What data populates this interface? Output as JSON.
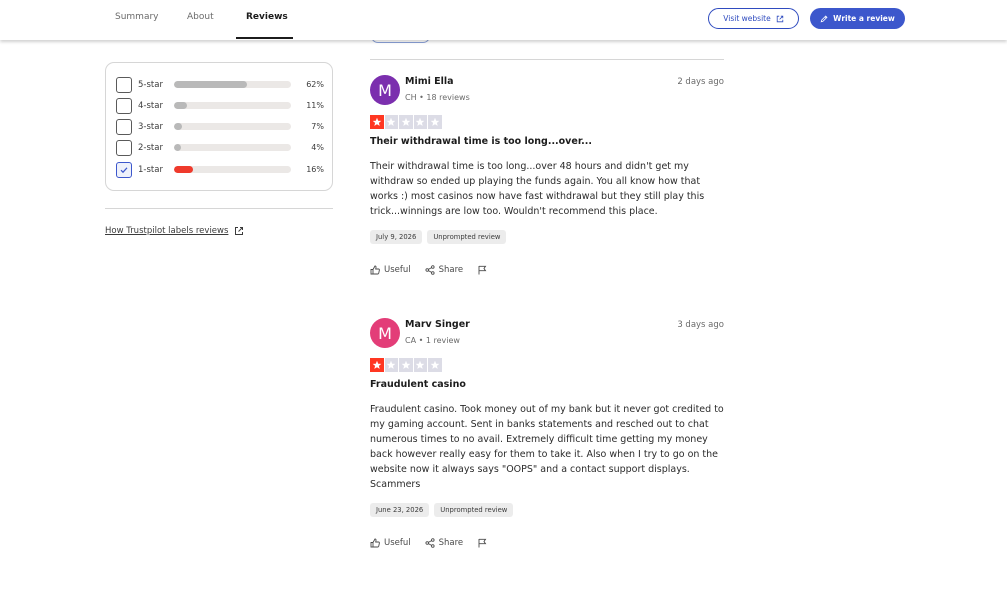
{
  "nav": {
    "tabs": [
      {
        "label": "Summary",
        "active": false
      },
      {
        "label": "About",
        "active": false
      },
      {
        "label": "Reviews",
        "active": true
      }
    ],
    "visit_label": "Visit website",
    "write_label": "Write a review"
  },
  "filter": {
    "rows": [
      {
        "label": "5-star",
        "percent": "62%",
        "fill": 0.62,
        "checked": false
      },
      {
        "label": "4-star",
        "percent": "11%",
        "fill": 0.11,
        "checked": false
      },
      {
        "label": "3-star",
        "percent": "7%",
        "fill": 0.07,
        "checked": false
      },
      {
        "label": "2-star",
        "percent": "4%",
        "fill": 0.04,
        "checked": false
      },
      {
        "label": "1-star",
        "percent": "16%",
        "fill": 0.16,
        "checked": true
      }
    ],
    "labels_link": "How Trustpilot labels reviews"
  },
  "reviews": [
    {
      "initial": "M",
      "avatar_color": "#7b2fae",
      "name": "Mimi Ella",
      "meta": "CH • 18 reviews",
      "date": "2 days ago",
      "rating": 1,
      "title": "Their withdrawal time is too long...over...",
      "body": "Their withdrawal time is too long...over 48 hours and didn't get my withdraw so ended up playing the funds again. You all know how that works :) most casinos now have fast withdrawal but they still play this trick...winnings are low too. Wouldn't recommend this place.",
      "experience_date": "July 9, 2026",
      "label": "Unprompted review",
      "useful": "Useful",
      "share": "Share"
    },
    {
      "initial": "M",
      "avatar_color": "#e33d78",
      "name": "Marv Singer",
      "meta": "CA • 1 review",
      "date": "3 days ago",
      "rating": 1,
      "title": "Fraudulent casino",
      "body": "Fraudulent casino. Took money out of my bank but it never got credited to my gaming account. Sent in banks statements and resched out to chat numerous times to no avail. Extremely difficult time getting my money back however really easy for them to take it. Also when I try to go on the website now it always says \"OOPS\" and a contact support displays. Scammers",
      "experience_date": "June 23, 2026",
      "label": "Unprompted review",
      "useful": "Useful",
      "share": "Share"
    }
  ],
  "colors": {
    "accent": "#3c57cc",
    "star_red": "#ff3722",
    "bar_red": "#ef3a2c",
    "bar_gray": "#b9b9b9"
  }
}
